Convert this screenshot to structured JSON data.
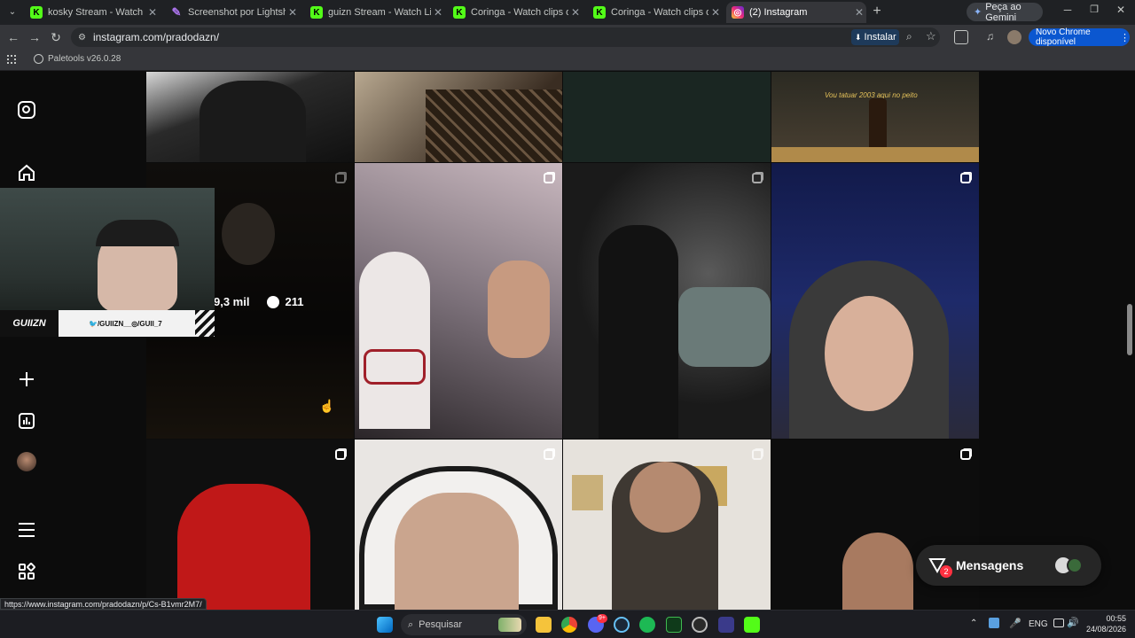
{
  "browser": {
    "tabs": [
      {
        "title": "kosky Stream - Watch Live on Kick",
        "icon": "kick-icon"
      },
      {
        "title": "Screenshot por Lightshot",
        "icon": "lightshot-icon"
      },
      {
        "title": "guizn Stream - Watch Live on Kick",
        "icon": "kick-icon"
      },
      {
        "title": "Coringa - Watch clips on Kick",
        "icon": "kick-icon"
      },
      {
        "title": "Coringa - Watch clips on Kick",
        "icon": "kick-icon"
      },
      {
        "title": "(2) Instagram",
        "icon": "instagram-icon",
        "active": true
      }
    ],
    "new_tab": "+",
    "gemini_label": "Peça ao Gemini",
    "url": "instagram.com/pradodazn/",
    "install_label": "Instalar",
    "update_label": "Novo Chrome disponível",
    "bookmark": "Paletools v26.0.28",
    "status_url": "https://www.instagram.com/pradodazn/p/Cs-B1vmr2M7/"
  },
  "overlay": {
    "likes": "9,3 mil",
    "comments": "211"
  },
  "grid": {
    "top_caption": "Vou tatuar 2003 aqui no peito"
  },
  "webcam": {
    "logo": "GUIIZN",
    "socials": "🐦/GUIIZN__◎/GUII_7"
  },
  "messages": {
    "label": "Mensagens",
    "badge": "2"
  },
  "taskbar": {
    "search_placeholder": "Pesquisar",
    "lang": "ENG",
    "time": "00:55",
    "date": "24/08/2026",
    "badge": "9+"
  },
  "colors": {
    "accent": "#0095f6",
    "badge": "#ff3040",
    "kick": "#53fc18"
  }
}
